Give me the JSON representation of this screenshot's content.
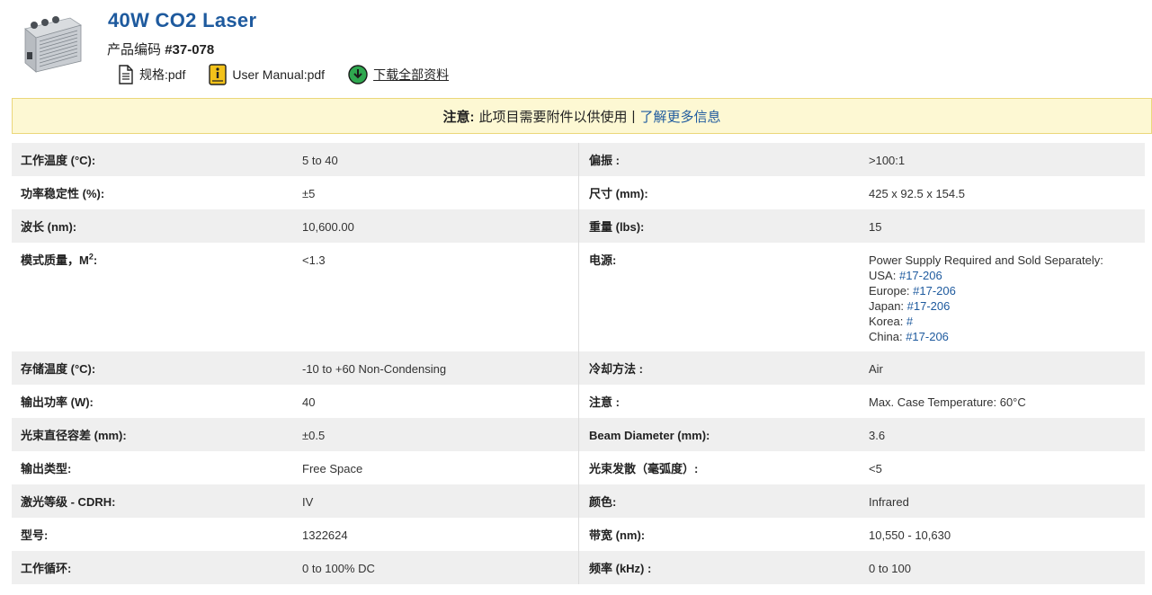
{
  "product": {
    "title": "40W CO2 Laser",
    "code_label": "产品编码",
    "code_value": "#37-078"
  },
  "documents": [
    {
      "label": "规格:pdf",
      "icon": "document-icon"
    },
    {
      "label": "User Manual:pdf",
      "icon": "info-manual-icon"
    },
    {
      "label": "下载全部资料",
      "icon": "download-icon"
    }
  ],
  "notice": {
    "label": "注意:",
    "text": "此项目需要附件以供使用",
    "separator": "|",
    "link": "了解更多信息"
  },
  "specs": {
    "rows": [
      {
        "l_label": "工作温度 (°C):",
        "l_value": "5 to 40",
        "r_label": "偏振 :",
        "r_value": ">100:1"
      },
      {
        "l_label": "功率稳定性 (%):",
        "l_value": "±5",
        "r_label": "尺寸 (mm):",
        "r_value": "425 x 92.5 x 154.5"
      },
      {
        "l_label": "波长 (nm):",
        "l_value": "10,600.00",
        "r_label": "重量 (lbs):",
        "r_value": "15"
      },
      {
        "l_label_main": "模式质量，M",
        "l_label_sup": "2",
        "l_label_end": ":",
        "l_value": "<1.3",
        "r_label": "电源:",
        "power_heading": "Power Supply Required and Sold Separately:",
        "power_lines": [
          {
            "region": "USA: ",
            "link": "#17-206"
          },
          {
            "region": "Europe: ",
            "link": "#17-206"
          },
          {
            "region": "Japan: ",
            "link": "#17-206"
          },
          {
            "region": "Korea: ",
            "link": "#"
          },
          {
            "region": "China: ",
            "link": "#17-206"
          }
        ]
      },
      {
        "l_label": "存储温度 (°C):",
        "l_value": "-10 to +60 Non-Condensing",
        "r_label": "冷却方法 :",
        "r_value": "Air"
      },
      {
        "l_label": "输出功率 (W):",
        "l_value": "40",
        "r_label": "注意 :",
        "r_value": "Max. Case Temperature: 60°C"
      },
      {
        "l_label": "光束直径容差 (mm):",
        "l_value": "±0.5",
        "r_label": "Beam Diameter (mm):",
        "r_value": "3.6"
      },
      {
        "l_label": "输出类型:",
        "l_value": "Free Space",
        "r_label": "光束发散（毫弧度）:",
        "r_value": "<5"
      },
      {
        "l_label": "激光等级 - CDRH:",
        "l_value": "IV",
        "r_label": "颜色:",
        "r_value": "Infrared"
      },
      {
        "l_label": "型号:",
        "l_value": "1322624",
        "r_label": "带宽 (nm):",
        "r_value": "10,550 - 10,630"
      },
      {
        "l_label": "工作循环:",
        "l_value": "0 to 100% DC",
        "r_label": "频率 (kHz) :",
        "r_value": "0 to 100"
      }
    ]
  },
  "colors": {
    "title_blue": "#1e5a9e",
    "notice_bg": "#fdf8d3",
    "row_shade": "#efefef",
    "download_green": "#2fa84f"
  }
}
